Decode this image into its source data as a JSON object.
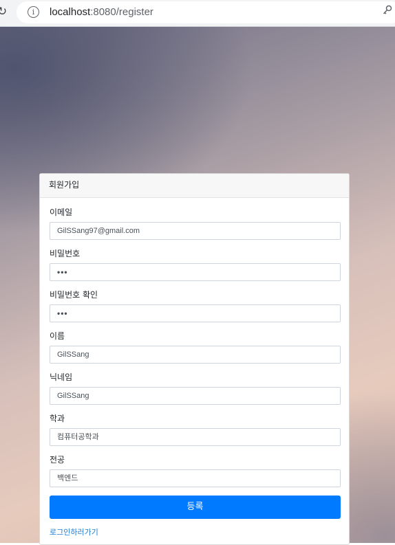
{
  "browser": {
    "url_host": "localhost",
    "url_rest": ":8080/register"
  },
  "card": {
    "title": "회원가입",
    "fields": [
      {
        "label": "이메일",
        "value": "GilSSang97@gmail.com"
      },
      {
        "label": "비밀번호",
        "value": "•••"
      },
      {
        "label": "비밀번호 확인",
        "value": "•••"
      },
      {
        "label": "이름",
        "value": "GilSSang"
      },
      {
        "label": "닉네임",
        "value": "GilSSang"
      },
      {
        "label": "학과",
        "value": "컴퓨터공학과"
      },
      {
        "label": "전공",
        "value": "백엔드"
      }
    ],
    "submit_label": "등록",
    "login_link": "로그인하러가기"
  },
  "colors": {
    "primary": "#007bff",
    "link": "#1a7cd6"
  },
  "icons": {
    "reload": "reload-icon",
    "info": "info-icon",
    "key": "key-icon"
  }
}
